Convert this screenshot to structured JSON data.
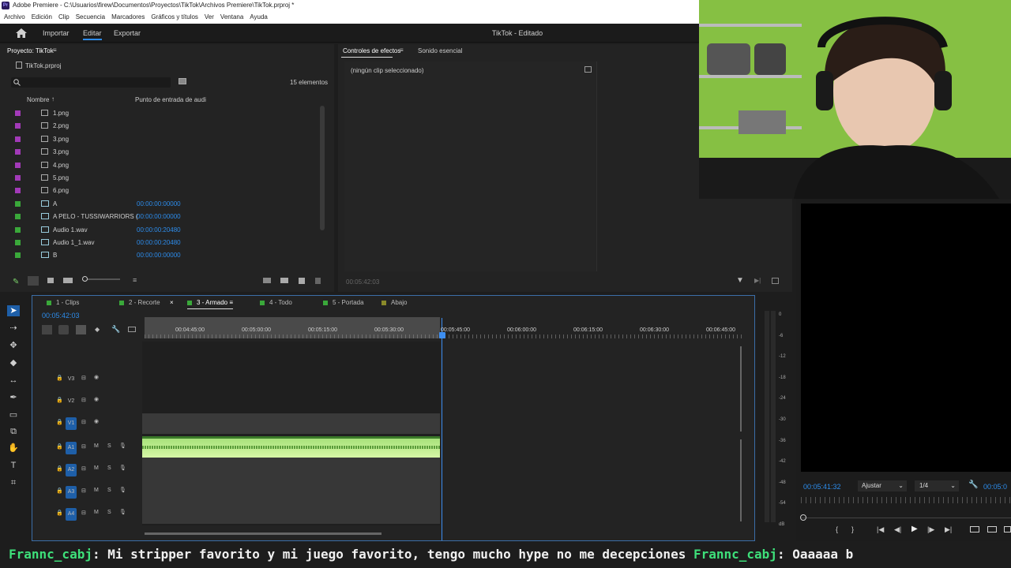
{
  "window": {
    "title": "Adobe Premiere - C:\\Usuarios\\firew\\Documentos\\Proyectos\\TikTok\\Archivos Premiere\\TikTok.prproj *"
  },
  "menu": [
    "Archivo",
    "Edición",
    "Clip",
    "Secuencia",
    "Marcadores",
    "Gráficos y títulos",
    "Ver",
    "Ventana",
    "Ayuda"
  ],
  "header": {
    "import": "Importar",
    "edit": "Editar",
    "export": "Exportar",
    "doc_title": "TikTok - Editado"
  },
  "project": {
    "tab": "Proyecto: TikTok",
    "file": "TikTok.prproj",
    "count": "15 elementos",
    "col_name": "Nombre",
    "col_in": "Punto de entrada de audi",
    "items": [
      {
        "name": "1.png",
        "tc": "",
        "color": "#a23ab8"
      },
      {
        "name": "2.png",
        "tc": "",
        "color": "#a23ab8"
      },
      {
        "name": "3.png",
        "tc": "",
        "color": "#a23ab8"
      },
      {
        "name": "3.png",
        "tc": "",
        "color": "#a23ab8"
      },
      {
        "name": "4.png",
        "tc": "",
        "color": "#a23ab8"
      },
      {
        "name": "5.png",
        "tc": "",
        "color": "#a23ab8"
      },
      {
        "name": "6.png",
        "tc": "",
        "color": "#a23ab8"
      },
      {
        "name": "A",
        "tc": "00:00:00:00000",
        "color": "#3aa83a"
      },
      {
        "name": "A PELO - TUSSIWARRIORS (",
        "tc": "00:00:00:00000",
        "color": "#3aa83a"
      },
      {
        "name": "Audio 1.wav",
        "tc": "00:00:00:20480",
        "color": "#3aa83a"
      },
      {
        "name": "Audio 1_1.wav",
        "tc": "00:00:00:20480",
        "color": "#3aa83a"
      },
      {
        "name": "B",
        "tc": "00:00:00:00000",
        "color": "#3aa83a"
      }
    ]
  },
  "effects": {
    "tab1": "Controles de efectos",
    "tab2": "Sonido esencial",
    "empty": "(ningún clip seleccionado)",
    "tc": "00:05:42:03"
  },
  "timeline": {
    "tabs": [
      "1 - Clips",
      "2 - Recorte",
      "3 - Armado",
      "4 - Todo",
      "5 - Portada",
      "Abajo"
    ],
    "timecode": "00:05:42:03",
    "ruler": [
      "00:04:45:00",
      "00:05:00:00",
      "00:05:15:00",
      "00:05:30:00",
      "00:05:45:00",
      "00:06:00:00",
      "00:06:15:00",
      "00:06:30:00",
      "00:06:45:00"
    ],
    "video_tracks": [
      "V3",
      "V2",
      "V1"
    ],
    "audio_tracks": [
      "A1",
      "A2",
      "A3",
      "A4"
    ],
    "m": "M",
    "s": "S"
  },
  "meter": {
    "db": [
      "0",
      "-6",
      "-12",
      "-18",
      "-24",
      "-30",
      "-36",
      "-42",
      "-48",
      "-54",
      "dB"
    ]
  },
  "program": {
    "tc": "00:05:41:32",
    "fit": "Ajustar",
    "res": "1/4",
    "tc2": "00:05:0"
  },
  "chat": {
    "user1": "Frannc_cabj",
    "msg1": ": Mi stripper favorito y mi juego favorito, tengo mucho hype no me decepciones ",
    "user2": "Frannc_cabj",
    "msg2": ": Oaaaaa b"
  }
}
